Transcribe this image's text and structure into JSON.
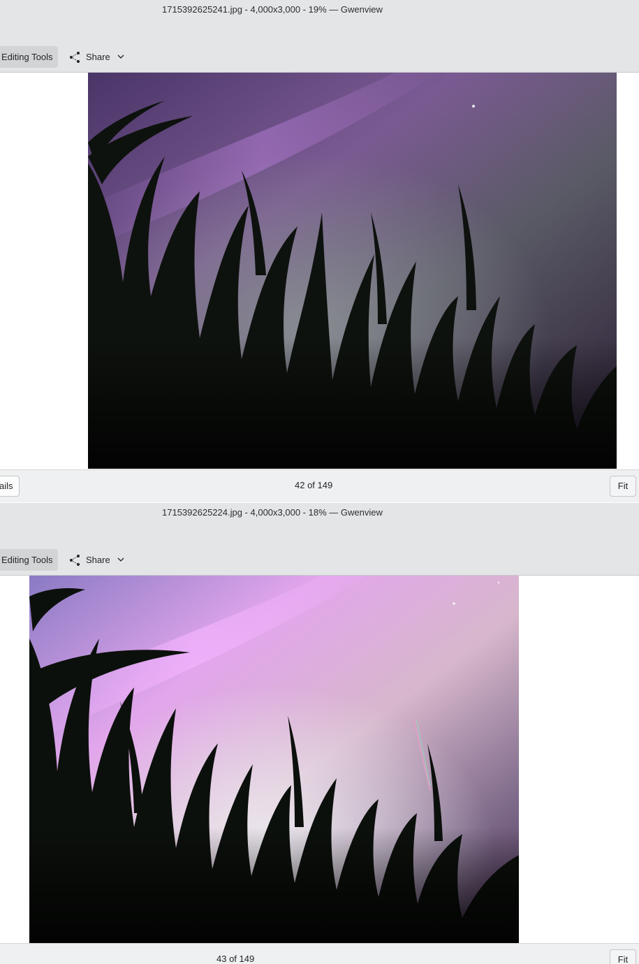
{
  "windows": [
    {
      "title": "1715392625241.jpg - 4,000x3,000 - 19% — Gwenview",
      "toolbar": {
        "editing_tools": "Editing Tools",
        "share": "Share"
      },
      "statusbar": {
        "thumbnails_button": "ails",
        "counter": "42 of 149",
        "fit_button": "Fit"
      }
    },
    {
      "title": "1715392625224.jpg - 4,000x3,000 - 18% — Gwenview",
      "toolbar": {
        "editing_tools": "Editing Tools",
        "share": "Share"
      },
      "statusbar": {
        "counter": "43 of 149",
        "fit_button": "Fit"
      }
    }
  ],
  "colors": {
    "chrome": "#e3e5e7",
    "statusbar": "#eff0f1",
    "sky_purple_dark": "#5a4577",
    "sky_purple_light": "#d8a5ec",
    "grass": "#0d110d"
  }
}
